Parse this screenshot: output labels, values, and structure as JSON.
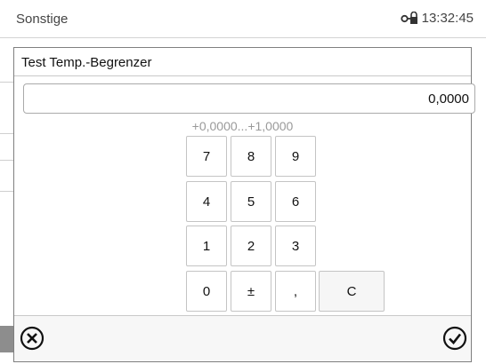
{
  "header": {
    "title": "Sonstige",
    "lock_icon": "lock-key-icon",
    "time": "13:32:45"
  },
  "dialog": {
    "title": "Test Temp.-Begrenzer",
    "value": "0,0000",
    "range": "+0,0000...+1,0000",
    "keys": {
      "k7": "7",
      "k8": "8",
      "k9": "9",
      "k4": "4",
      "k5": "5",
      "k6": "6",
      "k1": "1",
      "k2": "2",
      "k3": "3",
      "k0": "0",
      "sign": "±",
      "comma": ",",
      "clear": "C"
    },
    "cancel_icon": "cancel-circle-icon",
    "confirm_icon": "check-circle-icon"
  }
}
